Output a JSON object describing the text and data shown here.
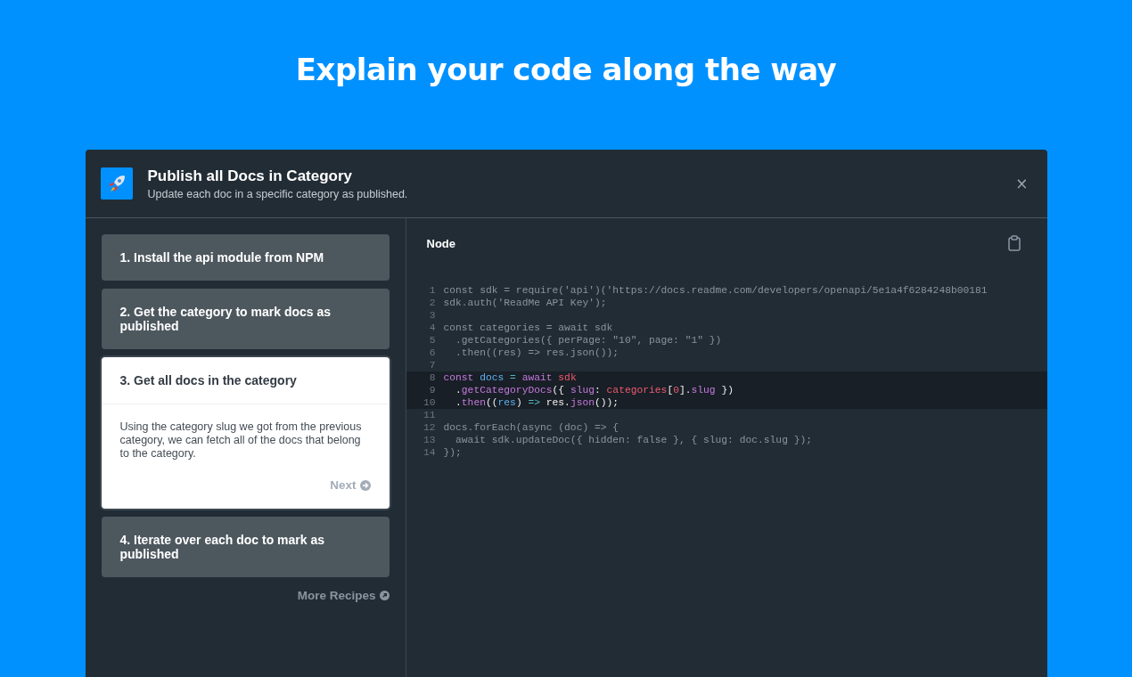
{
  "headline": "Explain your code along the way",
  "dialog": {
    "title": "Publish all Docs in Category",
    "subtitle": "Update each doc in a specific category as published.",
    "close": "×"
  },
  "steps": [
    {
      "title": "1. Install the api module from NPM",
      "selected": false
    },
    {
      "title": "2. Get the category to mark docs as published",
      "selected": false
    },
    {
      "title": "3. Get all docs in the category",
      "selected": true,
      "description": "Using the category slug we got from the previous category, we can fetch all of the docs that belong to the category.",
      "next": "Next"
    },
    {
      "title": "4. Iterate over each doc to mark as published",
      "selected": false
    }
  ],
  "more_link": "More Recipes",
  "code": {
    "language": "Node",
    "lines": [
      {
        "number": "1",
        "highlighted": false,
        "tokens": [
          {
            "text": "const sdk = require('api')('https://docs.readme.com/developers/openapi/5e1a4f6284248b00181",
            "kind": "plain"
          }
        ]
      },
      {
        "number": "2",
        "highlighted": false,
        "tokens": [
          {
            "text": "sdk.auth('ReadMe API Key');",
            "kind": "plain"
          }
        ]
      },
      {
        "number": "3",
        "highlighted": false
      },
      {
        "number": "4",
        "highlighted": false,
        "tokens": [
          {
            "text": "const categories = await sdk",
            "kind": "plain"
          }
        ]
      },
      {
        "number": "5",
        "highlighted": false,
        "tokens": [
          {
            "text": "  .getCategories({ perPage: \"10\", page: \"1\" })",
            "kind": "plain"
          }
        ]
      },
      {
        "number": "6",
        "highlighted": false,
        "tokens": [
          {
            "text": "  .then((res) => res.json());",
            "kind": "plain"
          }
        ]
      },
      {
        "number": "7",
        "highlighted": false
      },
      {
        "number": "8",
        "highlighted": true,
        "tokens": [
          {
            "text": "const",
            "kind": "keyword"
          },
          {
            "text": " docs",
            "kind": "variable"
          },
          {
            "text": " =",
            "kind": "operator"
          },
          {
            "text": " await",
            "kind": "keyword"
          },
          {
            "text": " sdk",
            "kind": "object"
          }
        ]
      },
      {
        "number": "9",
        "highlighted": true,
        "tokens": [
          {
            "text": "  .",
            "kind": "punct"
          },
          {
            "text": "getCategoryDocs",
            "kind": "keyword"
          },
          {
            "text": "({ ",
            "kind": "punct"
          },
          {
            "text": "slug",
            "kind": "keyword"
          },
          {
            "text": ": ",
            "kind": "punct"
          },
          {
            "text": "categories",
            "kind": "object"
          },
          {
            "text": "[",
            "kind": "punct"
          },
          {
            "text": "0",
            "kind": "object"
          },
          {
            "text": "].",
            "kind": "punct"
          },
          {
            "text": "slug",
            "kind": "keyword"
          },
          {
            "text": " })",
            "kind": "punct"
          }
        ]
      },
      {
        "number": "10",
        "highlighted": true,
        "tokens": [
          {
            "text": "  .",
            "kind": "punct"
          },
          {
            "text": "then",
            "kind": "keyword"
          },
          {
            "text": "((",
            "kind": "punct"
          },
          {
            "text": "res",
            "kind": "variable"
          },
          {
            "text": ") ",
            "kind": "punct"
          },
          {
            "text": "=>",
            "kind": "operator"
          },
          {
            "text": " res.",
            "kind": "punct"
          },
          {
            "text": "json",
            "kind": "keyword"
          },
          {
            "text": "());",
            "kind": "punct"
          }
        ]
      },
      {
        "number": "11",
        "highlighted": false
      },
      {
        "number": "12",
        "highlighted": false,
        "tokens": [
          {
            "text": "docs.forEach(async (doc) => {",
            "kind": "plain"
          }
        ]
      },
      {
        "number": "13",
        "highlighted": false,
        "tokens": [
          {
            "text": "  await sdk.updateDoc({ hidden: false }, { slug: doc.slug });",
            "kind": "plain"
          }
        ]
      },
      {
        "number": "14",
        "highlighted": false,
        "tokens": [
          {
            "text": "});",
            "kind": "plain"
          }
        ]
      }
    ]
  }
}
